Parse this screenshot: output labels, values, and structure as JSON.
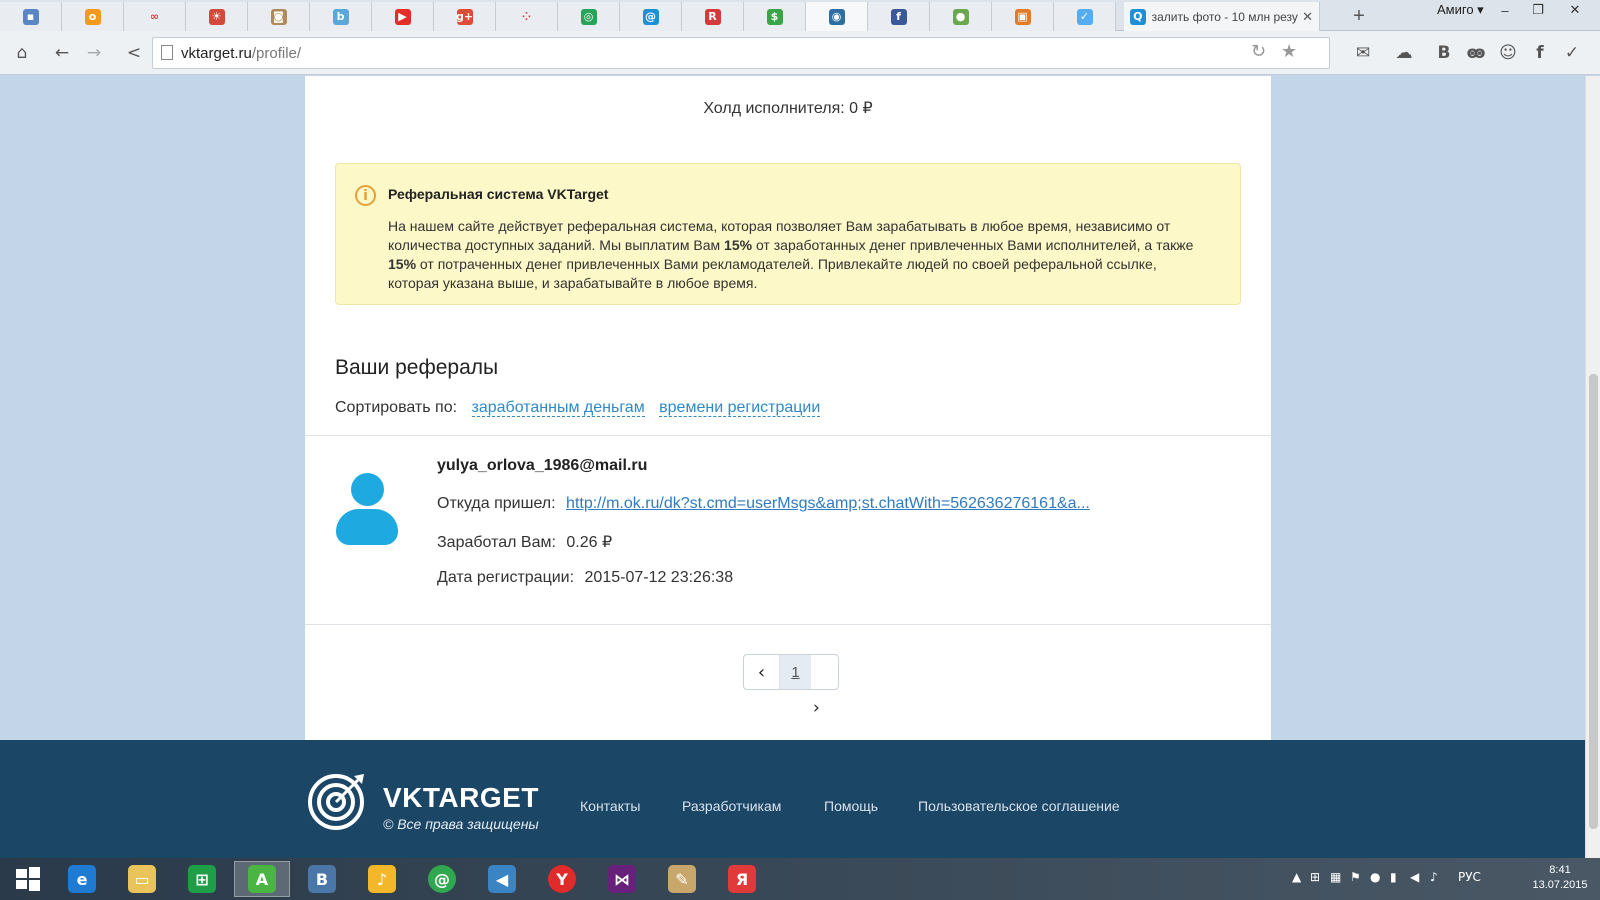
{
  "browser": {
    "tabs": [
      {
        "icon": "blue-square-icon",
        "color": "#5b86c5",
        "glyph": "▪"
      },
      {
        "icon": "odnoklassniki-icon",
        "color": "#f39a1e",
        "glyph": "о"
      },
      {
        "icon": "infinity-icon",
        "color": "#e9edf1",
        "glyph": "∞"
      },
      {
        "icon": "emblem-icon",
        "color": "#d24a3a",
        "glyph": "☀"
      },
      {
        "icon": "photo-icon",
        "color": "#b08a5a",
        "glyph": "◙"
      },
      {
        "icon": "letter-b-icon",
        "color": "#5aa7d8",
        "glyph": "b"
      },
      {
        "icon": "youtube-icon",
        "color": "#e52d27",
        "glyph": "▶"
      },
      {
        "icon": "google-plus-icon",
        "color": "#dd4b39",
        "glyph": "g+"
      },
      {
        "icon": "dots-icon",
        "color": "#e9edf1",
        "glyph": "⁘"
      },
      {
        "icon": "green-circle-icon",
        "color": "#27a35a",
        "glyph": "◎"
      },
      {
        "icon": "mail-at-icon",
        "color": "#1f8fd6",
        "glyph": "@"
      },
      {
        "icon": "letter-r-icon",
        "color": "#d33a3a",
        "glyph": "R"
      },
      {
        "icon": "green-s-icon",
        "color": "#3aa546",
        "glyph": "$"
      },
      {
        "icon": "target-icon",
        "color": "#2f6ea3",
        "glyph": "◉"
      },
      {
        "icon": "facebook-icon",
        "color": "#3b5998",
        "glyph": "f"
      },
      {
        "icon": "globe-icon",
        "color": "#6aa84f",
        "glyph": "●"
      },
      {
        "icon": "gift-icon",
        "color": "#e07b2a",
        "glyph": "▣"
      },
      {
        "icon": "twitter-icon",
        "color": "#55acee",
        "glyph": "✓"
      }
    ],
    "active_tab_title": "залить фото - 10 млн резу",
    "profile_label": "Амиго ▾",
    "url_host": "vktarget.ru",
    "url_path": "/profile/"
  },
  "page": {
    "hold_label": "Холд исполнителя:",
    "hold_value": "0 ₽",
    "notice_title": "Реферальная система VKTarget",
    "notice_text_1": "На нашем сайте действует реферальная система, которая позволяет Вам зарабатывать в любое время, независимо от количества доступных заданий. Мы выплатим Вам ",
    "notice_pct_1": "15%",
    "notice_text_2": " от заработанных денег привлеченных Вами исполнителей, а также ",
    "notice_pct_2": "15%",
    "notice_text_3": " от потраченных денег привлеченных Вами рекламодателей. Привлекайте людей по своей реферальной ссылке, которая указана выше, и зарабатывайте в любое время.",
    "referrals_title": "Ваши рефералы",
    "sort_label": "Сортировать по:",
    "sort_options": [
      "заработанным деньгам",
      "времени регистрации"
    ],
    "referral": {
      "email": "yulya_orlova_1986@mail.ru",
      "source_label": "Откуда пришел:",
      "source_url": "http://m.ok.ru/dk?st.cmd=userMsgs&amp;st.chatWith=562636276161&a...",
      "earned_label": "Заработал Вам:",
      "earned_value": "0.26 ₽",
      "date_label": "Дата регистрации:",
      "date_value": "2015-07-12 23:26:38"
    },
    "pager_current": "1"
  },
  "footer": {
    "brand": "VKTARGET",
    "rights": "© Все права защищены",
    "links": [
      "Контакты",
      "Разработчикам",
      "Помощь",
      "Пользовательское соглашение"
    ]
  },
  "taskbar": {
    "language": "РУС",
    "time": "8:41",
    "date": "13.07.2015"
  }
}
